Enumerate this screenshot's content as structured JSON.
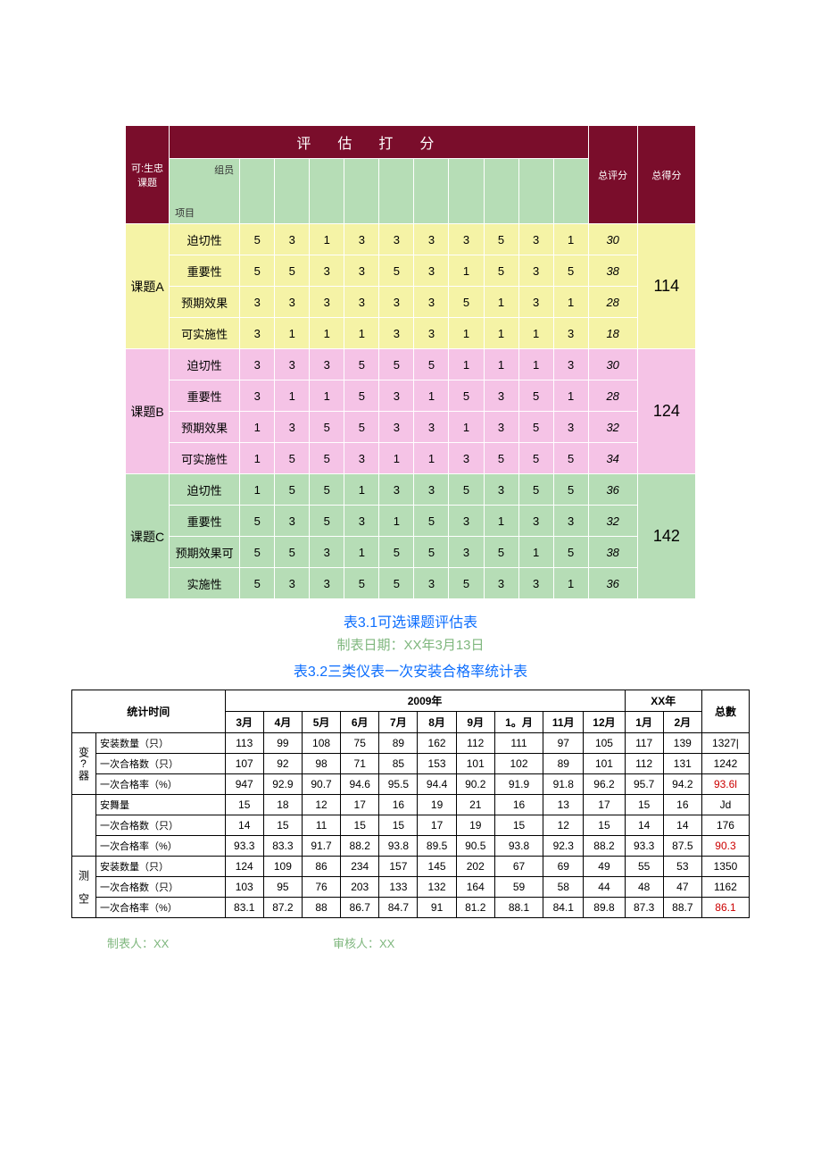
{
  "table1": {
    "header_left": "可:生忠课题",
    "header_title": "评估打分",
    "diag_top": "组员",
    "diag_bot": "项目",
    "score_label": "总评分",
    "total_label": "总得分",
    "topics": [
      {
        "name": "课题A",
        "class": "row-a",
        "rows": [
          {
            "label": "迫切性",
            "vals": [
              5,
              3,
              1,
              3,
              3,
              3,
              3,
              5,
              3,
              1
            ],
            "sum": 30
          },
          {
            "label": "重要性",
            "vals": [
              5,
              5,
              3,
              3,
              5,
              3,
              1,
              5,
              3,
              5
            ],
            "sum": 38
          },
          {
            "label": "预期效果",
            "vals": [
              3,
              3,
              3,
              3,
              3,
              3,
              5,
              1,
              3,
              1
            ],
            "sum": 28
          },
          {
            "label": "可实施性",
            "vals": [
              3,
              1,
              1,
              1,
              3,
              3,
              1,
              1,
              1,
              3
            ],
            "sum": 18
          }
        ],
        "total": 114
      },
      {
        "name": "课题B",
        "class": "row-b",
        "rows": [
          {
            "label": "迫切性",
            "vals": [
              3,
              3,
              3,
              5,
              5,
              5,
              1,
              1,
              1,
              3
            ],
            "sum": 30
          },
          {
            "label": "重要性",
            "vals": [
              3,
              1,
              1,
              5,
              3,
              1,
              5,
              3,
              5,
              1
            ],
            "sum": 28
          },
          {
            "label": "预期效果",
            "vals": [
              1,
              3,
              5,
              5,
              3,
              3,
              1,
              3,
              5,
              3
            ],
            "sum": 32
          },
          {
            "label": "可实施性",
            "vals": [
              1,
              5,
              5,
              3,
              1,
              1,
              3,
              5,
              5,
              5
            ],
            "sum": 34
          }
        ],
        "total": 124
      },
      {
        "name": "课题C",
        "class": "row-c",
        "rows": [
          {
            "label": "迫切性",
            "vals": [
              1,
              5,
              5,
              1,
              3,
              3,
              5,
              3,
              5,
              5
            ],
            "sum": 36
          },
          {
            "label": "重要性",
            "vals": [
              5,
              3,
              5,
              3,
              1,
              5,
              3,
              1,
              3,
              3
            ],
            "sum": 32
          },
          {
            "label": "预期效果可",
            "vals": [
              5,
              5,
              3,
              1,
              5,
              5,
              3,
              5,
              1,
              5
            ],
            "sum": 38
          },
          {
            "label": "实施性",
            "vals": [
              5,
              3,
              3,
              5,
              5,
              3,
              5,
              3,
              3,
              1
            ],
            "sum": 36
          }
        ],
        "total": 142
      }
    ]
  },
  "caption1": "表3.1可选课题评估表",
  "caption1b": "制表日期：XX年3月13日",
  "caption2": "表3.2三类仪表一次安装合格率统计表",
  "table2": {
    "stat_time": "统计时间",
    "year1": "2009年",
    "year2": "XX年",
    "total_col": "总數",
    "months": [
      "3月",
      "4月",
      "5月",
      "6月",
      "7月",
      "8月",
      "9月",
      "1。月",
      "11月",
      "12月",
      "1月",
      "2月"
    ],
    "groups": [
      {
        "name": "变?器",
        "rows": [
          {
            "label": "安装数量（只）",
            "vals": [
              113,
              99,
              108,
              75,
              89,
              162,
              112,
              111,
              97,
              105,
              117,
              139
            ],
            "total": "1327|"
          },
          {
            "label": "一次合格数（只）",
            "vals": [
              107,
              92,
              98,
              71,
              85,
              153,
              101,
              102,
              89,
              101,
              112,
              131
            ],
            "total": 1242
          },
          {
            "label": "一次合格率（%）",
            "vals": [
              947,
              92.9,
              90.7,
              94.6,
              95.5,
              94.4,
              90.2,
              91.9,
              91.8,
              96.2,
              95.7,
              94.2
            ],
            "total": "93.6l",
            "red": true
          }
        ]
      },
      {
        "name": "",
        "rows": [
          {
            "label": "安舞量",
            "vals": [
              15,
              18,
              12,
              17,
              16,
              19,
              21,
              16,
              13,
              17,
              15,
              16
            ],
            "total": "Jd"
          },
          {
            "label": "一次合格数（只）",
            "vals": [
              14,
              15,
              11,
              15,
              15,
              17,
              19,
              15,
              12,
              15,
              14,
              14
            ],
            "total": 176
          },
          {
            "label": "一次合格率（%）",
            "vals": [
              93.3,
              83.3,
              91.7,
              88.2,
              93.8,
              89.5,
              90.5,
              93.8,
              92.3,
              88.2,
              93.3,
              87.5
            ],
            "total": "90.3",
            "red": true
          }
        ]
      },
      {
        "name": "测 空",
        "rows": [
          {
            "label": "安装数量（只）",
            "vals": [
              124,
              109,
              86,
              234,
              157,
              145,
              202,
              67,
              69,
              49,
              55,
              53
            ],
            "total": 1350
          },
          {
            "label": "一次合格数（只）",
            "vals": [
              103,
              95,
              76,
              203,
              133,
              132,
              164,
              59,
              58,
              44,
              48,
              47
            ],
            "total": 1162
          },
          {
            "label": "一次合格率（%）",
            "vals": [
              83.1,
              87.2,
              88,
              86.7,
              84.7,
              91,
              81.2,
              "88.1",
              "84.1",
              89.8,
              87.3,
              88.7
            ],
            "total": "86.1",
            "red": true
          }
        ]
      }
    ]
  },
  "footer_left": "制表人：XX",
  "footer_right": "审核人：XX"
}
